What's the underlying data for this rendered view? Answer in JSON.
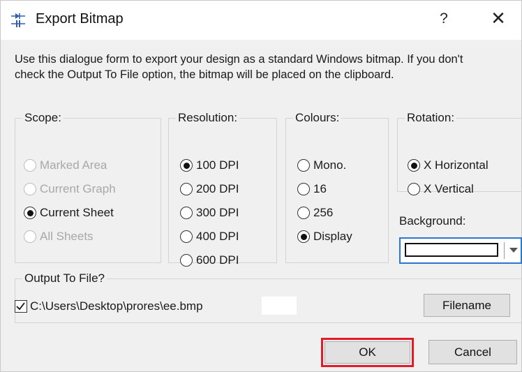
{
  "window": {
    "title": "Export Bitmap",
    "help_label": "?",
    "close_label": "✕",
    "icon": "export-bitmap-app-icon"
  },
  "description": {
    "line1": "Use this dialogue form to export your design as a standard Windows bitmap. If you don't",
    "line2": "check the Output To File option, the bitmap will be placed on the clipboard."
  },
  "scope": {
    "label": "Scope:",
    "options": [
      {
        "label": "Marked Area",
        "checked": false,
        "enabled": false
      },
      {
        "label": "Current Graph",
        "checked": false,
        "enabled": false
      },
      {
        "label": "Current Sheet",
        "checked": true,
        "enabled": true
      },
      {
        "label": "All Sheets",
        "checked": false,
        "enabled": false
      }
    ]
  },
  "resolution": {
    "label": "Resolution:",
    "options": [
      {
        "label": "100 DPI",
        "checked": true,
        "enabled": true
      },
      {
        "label": "200 DPI",
        "checked": false,
        "enabled": true
      },
      {
        "label": "300 DPI",
        "checked": false,
        "enabled": true
      },
      {
        "label": "400 DPI",
        "checked": false,
        "enabled": true
      },
      {
        "label": "600 DPI",
        "checked": false,
        "enabled": true
      }
    ]
  },
  "colours": {
    "label": "Colours:",
    "options": [
      {
        "label": "Mono.",
        "checked": false,
        "enabled": true
      },
      {
        "label": "16",
        "checked": false,
        "enabled": true
      },
      {
        "label": "256",
        "checked": false,
        "enabled": true
      },
      {
        "label": "Display",
        "checked": true,
        "enabled": true
      }
    ]
  },
  "rotation": {
    "label": "Rotation:",
    "options": [
      {
        "label": "X Horizontal",
        "checked": true,
        "enabled": true
      },
      {
        "label": "X Vertical",
        "checked": false,
        "enabled": true
      }
    ]
  },
  "background": {
    "label": "Background:",
    "selected_color": "#ffffff"
  },
  "output": {
    "label": "Output To File?",
    "checked": true,
    "path": "C:\\Users\\Desktop\\prores\\ee.bmp",
    "filename_button": "Filename"
  },
  "buttons": {
    "ok": "OK",
    "cancel": "Cancel"
  },
  "colors": {
    "dialog_bg": "#f0f0f0",
    "titlebar_bg": "#ffffff",
    "ok_highlight": "#e21b2a",
    "focus_blue": "#2b77d0",
    "disabled_text": "#a8a8a8"
  }
}
